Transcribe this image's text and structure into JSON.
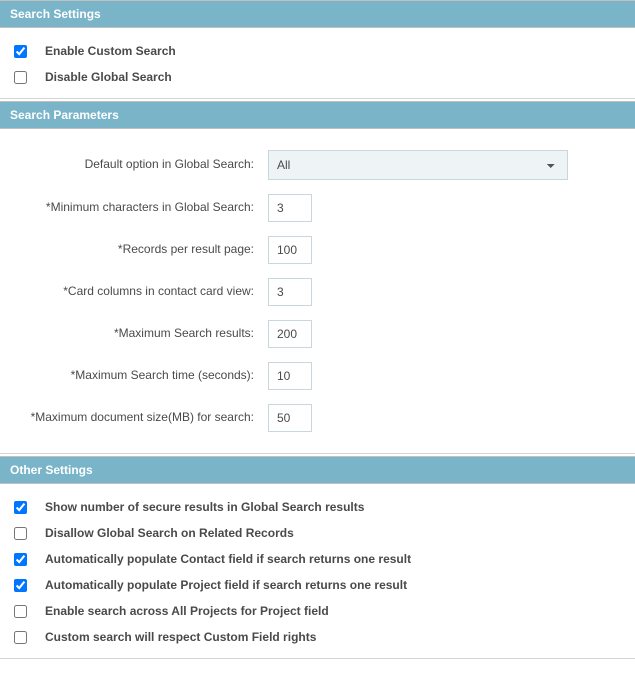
{
  "sections": {
    "search_settings": {
      "title": "Search Settings",
      "items": [
        {
          "label": "Enable Custom Search",
          "checked": true
        },
        {
          "label": "Disable Global Search",
          "checked": false
        }
      ]
    },
    "search_parameters": {
      "title": "Search Parameters",
      "fields": {
        "default_option": {
          "label": "Default option in Global Search:",
          "value": "All"
        },
        "min_chars": {
          "label": "*Minimum characters in Global Search:",
          "value": "3"
        },
        "records_per_page": {
          "label": "*Records per result page:",
          "value": "100"
        },
        "card_columns": {
          "label": "*Card columns in contact card view:",
          "value": "3"
        },
        "max_results": {
          "label": "*Maximum Search results:",
          "value": "200"
        },
        "max_time": {
          "label": "*Maximum Search time (seconds):",
          "value": "10"
        },
        "max_doc_size": {
          "label": "*Maximum document size(MB) for search:",
          "value": "50"
        }
      }
    },
    "other_settings": {
      "title": "Other Settings",
      "items": [
        {
          "label": "Show number of secure results in Global Search results",
          "checked": true
        },
        {
          "label": "Disallow Global Search on Related Records",
          "checked": false
        },
        {
          "label": "Automatically populate Contact field if search returns one result",
          "checked": true
        },
        {
          "label": "Automatically populate Project field if search returns one result",
          "checked": true
        },
        {
          "label": "Enable search across All Projects for Project field",
          "checked": false
        },
        {
          "label": "Custom search will respect Custom Field rights",
          "checked": false
        }
      ]
    }
  }
}
